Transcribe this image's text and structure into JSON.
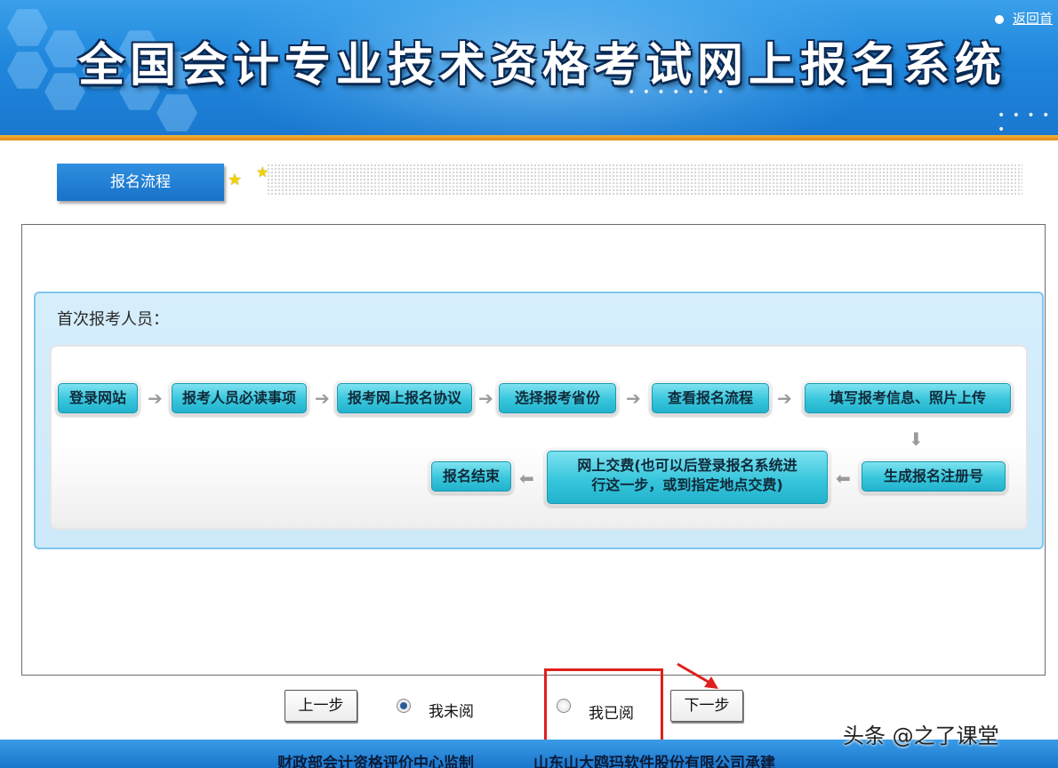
{
  "header": {
    "title": "全国会计专业技术资格考试网上报名系统",
    "return_link": "返回首"
  },
  "tab": {
    "label": "报名流程"
  },
  "flow": {
    "section_title": "首次报考人员：",
    "row1": [
      "登录网站",
      "报考人员必读事项",
      "报考网上报名协议",
      "选择报考省份",
      "查看报名流程",
      "填写报考信息、照片上传"
    ],
    "row2": {
      "generate": "生成报名注册号",
      "payment_line1": "网上交费(也可以后登录报名系统进",
      "payment_line2": "行这一步，或到指定地点交费)",
      "end": "报名结束"
    }
  },
  "controls": {
    "prev_button": "上一步",
    "radio_unread": "我未阅",
    "radio_read": "我已阅",
    "next_button": "下一步",
    "unread_checked": true
  },
  "footer": {
    "left": "财政部会计资格评价中心监制",
    "right": "山东山大鸥玛软件股份有限公司承建"
  },
  "watermark": "头条 @之了课堂",
  "colors": {
    "banner_blue": "#1f86dc",
    "orange_bar": "#e08a16",
    "step_cyan": "#37c6dc",
    "highlight_red": "#e0201c"
  }
}
